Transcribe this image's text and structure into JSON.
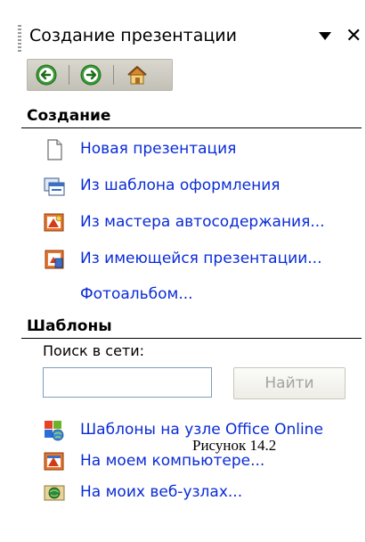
{
  "taskpane": {
    "title": "Создание презентации",
    "nav": {
      "back_icon": "back-arrow-icon",
      "forward_icon": "forward-arrow-icon",
      "home_icon": "home-icon"
    }
  },
  "create_section": {
    "header": "Создание",
    "items": [
      {
        "label": "Новая презентация",
        "icon": "blank-document-icon"
      },
      {
        "label": "Из шаблона оформления",
        "icon": "design-template-icon"
      },
      {
        "label": "Из мастера автосодержания...",
        "icon": "autocontent-wizard-icon"
      },
      {
        "label": "Из имеющейся презентации...",
        "icon": "existing-presentation-icon"
      },
      {
        "label": "Фотоальбом...",
        "icon": ""
      }
    ]
  },
  "templates_section": {
    "header": "Шаблоны",
    "search_label": "Поиск в сети:",
    "search_value": "",
    "find_button": "Найти",
    "items": [
      {
        "label": "Шаблоны на узле Office Online",
        "icon": "office-online-icon"
      },
      {
        "label": "На моем компьютере...",
        "icon": "my-computer-templates-icon"
      },
      {
        "label": "На моих веб-узлах...",
        "icon": "web-sites-icon"
      }
    ]
  },
  "caption": "Рисунок 14.2",
  "colors": {
    "link": "#0a2bd6",
    "nav_bar": "#c3c0b6",
    "nav_icon_green": "#3c9a36"
  }
}
